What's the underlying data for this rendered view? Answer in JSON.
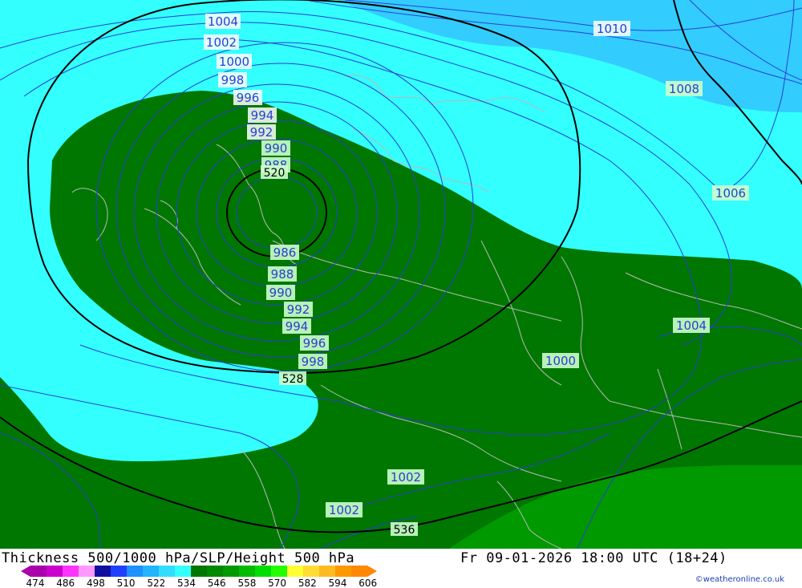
{
  "title": "Thickness 500/1000 hPa/SLP/Height 500 hPa",
  "valid_time": "Fr 09-01-2026 18:00 UTC (18+24)",
  "credit": "©weatheronline.co.uk",
  "colors": {
    "cyan_light": "#33ffff",
    "sky_blue": "#33ccff",
    "dark_green": "#007700",
    "medium_green": "#009900",
    "isobar": "#2a3fd0",
    "height_contour": "#000000",
    "border": "#b8b8b8"
  },
  "legend": {
    "labels": [
      "474",
      "486",
      "498",
      "510",
      "522",
      "534",
      "546",
      "558",
      "570",
      "582",
      "594",
      "606"
    ],
    "colors": [
      "#aa00aa",
      "#cc00cc",
      "#ff33ff",
      "#ff99ff",
      "#1010a0",
      "#2040ff",
      "#1e90ff",
      "#22b4ff",
      "#33ddff",
      "#33ffff",
      "#007700",
      "#008800",
      "#009900",
      "#00bb00",
      "#00dd00",
      "#22ff00",
      "#ffff33",
      "#ffdd33",
      "#ffbb22",
      "#ff9900",
      "#ff8800"
    ]
  },
  "isobar_labels": {
    "l1004_top": "1004",
    "l1002_top": "1002",
    "l1000_top": "1000",
    "l998_top": "998",
    "l996_top": "996",
    "l994_top": "994",
    "l992_top": "992",
    "l990_top": "990",
    "l988_top": "988",
    "l986": "986",
    "l988_bot": "988",
    "l990_bot": "990",
    "l992_bot": "992",
    "l994_bot": "994",
    "l996_bot": "996",
    "l998_bot": "998",
    "l1010": "1010",
    "l1008": "1008",
    "l1006": "1006",
    "l1004_right": "1004",
    "l1000_right": "1000",
    "l1002_bot": "1002",
    "l1002_bot2": "1002"
  },
  "height_labels": {
    "h520": "520",
    "h528": "528",
    "h536": "536"
  }
}
